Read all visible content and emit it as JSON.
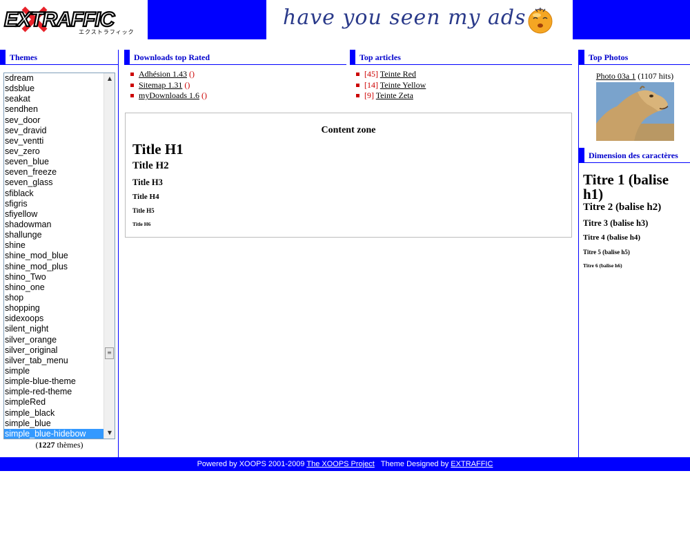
{
  "header": {
    "logo_text": "EXTRAFFIC",
    "logo_sub": "エクストラフィック",
    "banner_text": "have you seen my ads ?"
  },
  "themes": {
    "title": "Themes",
    "items": [
      "sdream",
      "sdsblue",
      "seakat",
      "sendhen",
      "sev_door",
      "sev_dravid",
      "sev_ventti",
      "sev_zero",
      "seven_blue",
      "seven_freeze",
      "seven_glass",
      "sfiblack",
      "sfigris",
      "sfiyellow",
      "shadowman",
      "shallunge",
      "shine",
      "shine_mod_blue",
      "shine_mod_plus",
      "shino_Two",
      "shino_one",
      "shop",
      "shopping",
      "sidexoops",
      "silent_night",
      "silver_orange",
      "silver_original",
      "silver_tab_menu",
      "simple",
      "simple-blue-theme",
      "simple-red-theme",
      "simpleRed",
      "simple_black",
      "simple_blue",
      "simple_blue-hidebow"
    ],
    "selected": "simple_blue-hidebow",
    "count": "1227",
    "count_label": "thèmes"
  },
  "downloads": {
    "title": "Downloads top Rated",
    "items": [
      {
        "label": "Adhésion 1.43",
        "suffix": "()"
      },
      {
        "label": "Sitemap 1.31",
        "suffix": "()"
      },
      {
        "label": "myDownloads 1.6",
        "suffix": "()"
      }
    ]
  },
  "articles": {
    "title": "Top articles",
    "items": [
      {
        "count": "[45]",
        "label": "Teinte Red"
      },
      {
        "count": "[14]",
        "label": "Teinte Yellow"
      },
      {
        "count": "[9]",
        "label": "Teinte Zeta"
      }
    ]
  },
  "content": {
    "title": "Content zone",
    "h1": "Title H1",
    "h2": "Title H2",
    "h3": "Title H3",
    "h4": "Title H4",
    "h5": "Title H5",
    "h6": "Title H6"
  },
  "photos": {
    "title": "Top Photos",
    "link": "Photo 03a 1",
    "hits": "(1107 hits)"
  },
  "dimensions": {
    "title": "Dimension des caractères",
    "t1": "Titre 1 (balise h1)",
    "t2": "Titre 2 (balise h2)",
    "t3": "Titre 3 (balise h3)",
    "t4": "Titre 4 (balise h4)",
    "t5": "Titre 5 (balise h5)",
    "t6": "Titre 6 (balise h6)"
  },
  "footer": {
    "powered": "Powered by XOOPS 2001-2009",
    "project_link": "The XOOPS Project",
    "designed": "Theme Designed by",
    "designer_link": "EXTRAFFIC"
  },
  "colors": {
    "accent": "#0000ff",
    "title_text": "#0000cc",
    "bullet": "#cc0000",
    "selected": "#3399ff"
  }
}
